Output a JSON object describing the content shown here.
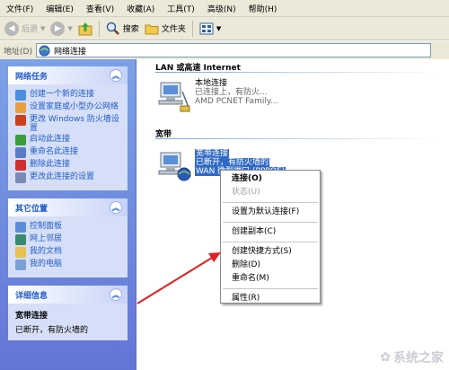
{
  "menubar": {
    "items": [
      "文件(F)",
      "编辑(E)",
      "查看(V)",
      "收藏(A)",
      "工具(T)",
      "高级(N)",
      "帮助(H)"
    ]
  },
  "toolbar": {
    "back_label": "后退",
    "search_label": "搜索",
    "folders_label": "文件夹"
  },
  "address": {
    "label": "地址(D)",
    "value": "网络连接"
  },
  "sidebar": {
    "network_tasks": {
      "title": "网络任务",
      "items": [
        "创建一个新的连接",
        "设置家庭或小型办公网络",
        "更改 Windows 防火墙设置",
        "启动此连接",
        "重命名此连接",
        "删除此连接",
        "更改此连接的设置"
      ]
    },
    "other_places": {
      "title": "其它位置",
      "items": [
        "控制面板",
        "网上邻居",
        "我的文档",
        "我的电脑"
      ]
    },
    "details": {
      "title": "详细信息",
      "name": "宽带连接",
      "status": "已断开，有防火墙的"
    }
  },
  "content": {
    "group_lan": "LAN 或高速 Internet",
    "local_conn": {
      "name": "本地连接",
      "status": "已连接上，有防火...",
      "device": "AMD PCNET Family..."
    },
    "group_broadband": "宽带",
    "broadband_conn": {
      "name": "宽带连接",
      "status": "已断开，有防火墙的",
      "device": "WAN 微型端口 (PPPOE)"
    }
  },
  "context_menu": {
    "connect": "连接(O)",
    "status": "状态(U)",
    "set_default": "设置为默认连接(F)",
    "create_copy": "创建副本(C)",
    "create_shortcut": "创建快捷方式(S)",
    "delete": "删除(D)",
    "rename": "重命名(M)",
    "properties": "属性(R)"
  },
  "watermark": "系统之家"
}
